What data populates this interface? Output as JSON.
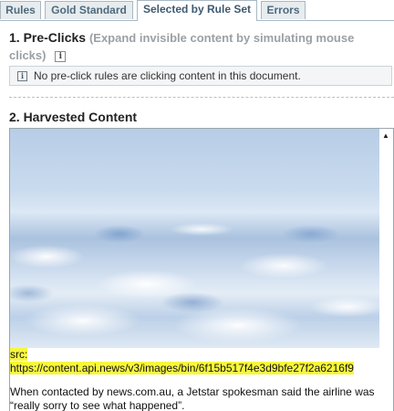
{
  "tabs": [
    {
      "label": "Rules",
      "active": false
    },
    {
      "label": "Gold Standard",
      "active": false
    },
    {
      "label": "Selected by Rule Set",
      "active": true
    },
    {
      "label": "Errors",
      "active": false
    }
  ],
  "section1": {
    "title": "1. Pre-Clicks",
    "subtitle": "(Expand invisible content by simulating mouse clicks)",
    "info_glyph": "i",
    "notice": "No pre-click rules are clicking content in this document."
  },
  "section2": {
    "title": "2. Harvested Content",
    "image_icon": "clouds-photo",
    "src_label": "src:",
    "src_url": "https://content.api.news/v3/images/bin/6f15b517f4e3d9bfe27f2a6216f9",
    "body_text": "When contacted by news.com.au, a Jetstar spokesman said the airline was “really sorry to see what happened”."
  },
  "colors": {
    "tab_active_bg": "#ffffff",
    "tab_inactive_bg": "#e7ecef",
    "highlight": "#f7f73d"
  }
}
